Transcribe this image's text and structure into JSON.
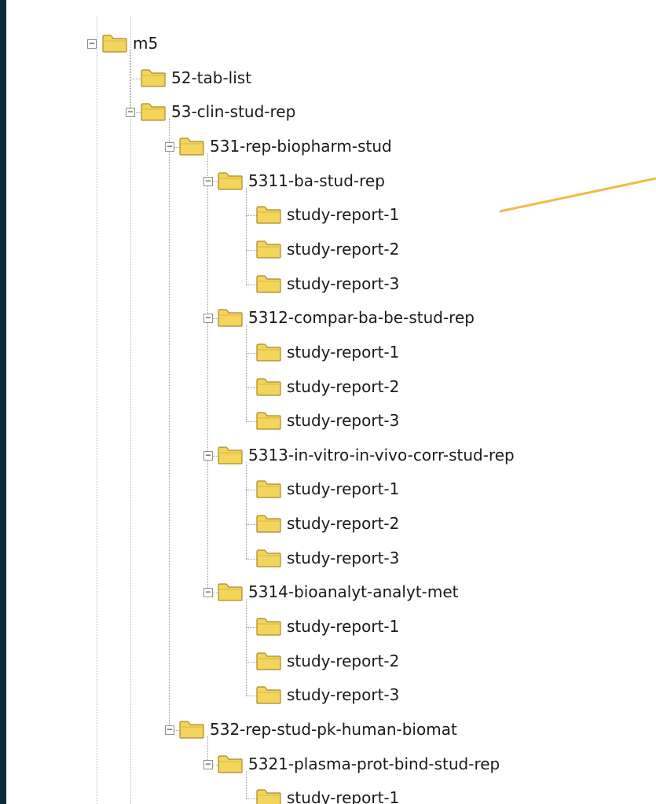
{
  "tree": [
    {
      "level": 0,
      "label": "m5",
      "toggle": "minus"
    },
    {
      "level": 1,
      "label": "52-tab-list",
      "toggle": ""
    },
    {
      "level": 1,
      "label": "53-clin-stud-rep",
      "toggle": "minus"
    },
    {
      "level": 2,
      "label": "531-rep-biopharm-stud",
      "toggle": "minus"
    },
    {
      "level": 3,
      "label": "5311-ba-stud-rep",
      "toggle": "minus"
    },
    {
      "level": 4,
      "label": "study-report-1",
      "toggle": ""
    },
    {
      "level": 4,
      "label": "study-report-2",
      "toggle": ""
    },
    {
      "level": 4,
      "label": "study-report-3",
      "toggle": ""
    },
    {
      "level": 3,
      "label": "5312-compar-ba-be-stud-rep",
      "toggle": "minus"
    },
    {
      "level": 4,
      "label": "study-report-1",
      "toggle": ""
    },
    {
      "level": 4,
      "label": "study-report-2",
      "toggle": ""
    },
    {
      "level": 4,
      "label": "study-report-3",
      "toggle": ""
    },
    {
      "level": 3,
      "label": "5313-in-vitro-in-vivo-corr-stud-rep",
      "toggle": "minus"
    },
    {
      "level": 4,
      "label": "study-report-1",
      "toggle": ""
    },
    {
      "level": 4,
      "label": "study-report-2",
      "toggle": ""
    },
    {
      "level": 4,
      "label": "study-report-3",
      "toggle": ""
    },
    {
      "level": 3,
      "label": "5314-bioanalyt-analyt-met",
      "toggle": "minus"
    },
    {
      "level": 4,
      "label": "study-report-1",
      "toggle": ""
    },
    {
      "level": 4,
      "label": "study-report-2",
      "toggle": ""
    },
    {
      "level": 4,
      "label": "study-report-3",
      "toggle": ""
    },
    {
      "level": 2,
      "label": "532-rep-stud-pk-human-biomat",
      "toggle": "minus"
    },
    {
      "level": 3,
      "label": "5321-plasma-prot-bind-stud-rep",
      "toggle": "minus"
    },
    {
      "level": 4,
      "label": "study-report-1",
      "toggle": ""
    }
  ],
  "colors": {
    "frame": "#0c2a3a",
    "folder_fill": "#f3d55b",
    "folder_stroke": "#a8892a",
    "arrow": "#f4b84a"
  },
  "icons": {
    "folder": "folder-icon",
    "expand": "minus-box-icon",
    "pointer": "arrow-line"
  }
}
